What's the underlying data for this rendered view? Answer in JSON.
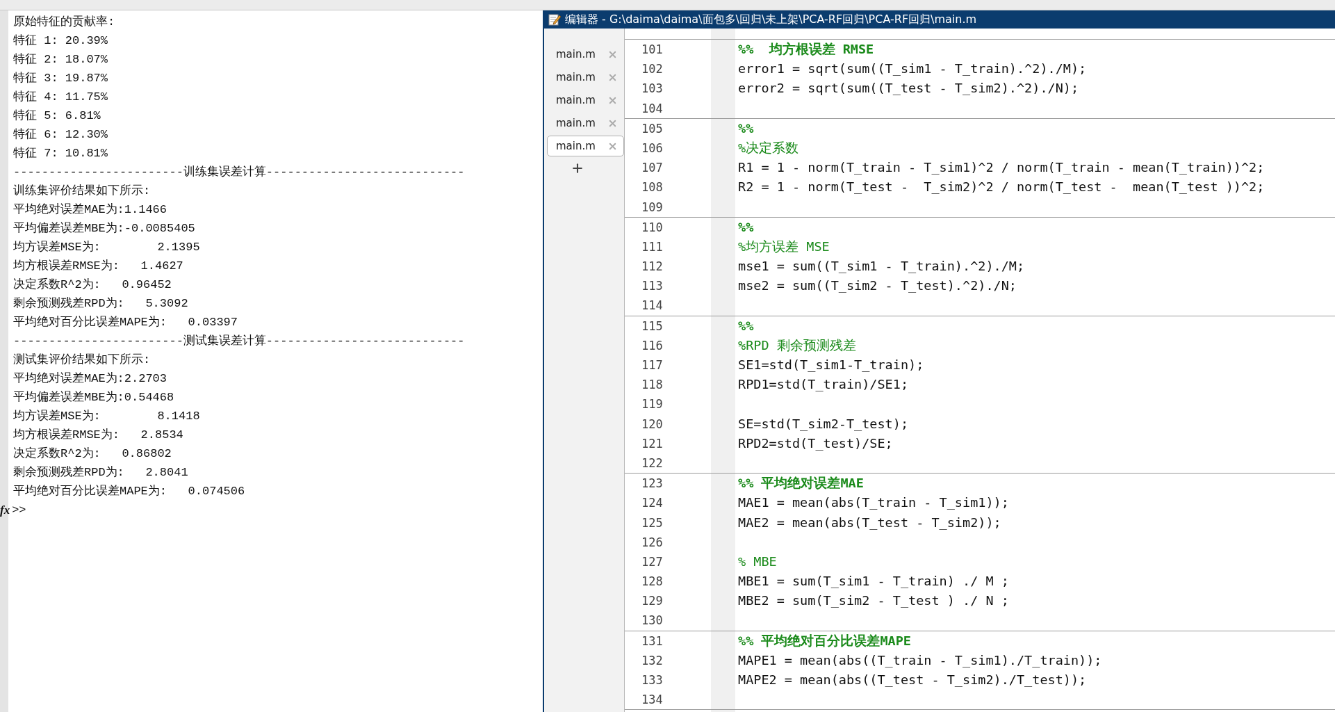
{
  "console": {
    "lines": [
      {
        "kind": "text",
        "text": "原始特征的贡献率:"
      },
      {
        "kind": "text",
        "text": "特征 1: 20.39%"
      },
      {
        "kind": "text",
        "text": "特征 2: 18.07%"
      },
      {
        "kind": "text",
        "text": "特征 3: 19.87%"
      },
      {
        "kind": "text",
        "text": "特征 4: 11.75%"
      },
      {
        "kind": "text",
        "text": "特征 5: 6.81%"
      },
      {
        "kind": "text",
        "text": "特征 6: 12.30%"
      },
      {
        "kind": "text",
        "text": "特征 7: 10.81%"
      },
      {
        "kind": "text",
        "text": "------------------------训练集误差计算----------------------------"
      },
      {
        "kind": "text",
        "text": "训练集评价结果如下所示:"
      },
      {
        "kind": "text",
        "text": "平均绝对误差MAE为:1.1466"
      },
      {
        "kind": "text",
        "text": "平均偏差误差MBE为:-0.0085405"
      },
      {
        "kind": "text",
        "text": "均方误差MSE为:        2.1395"
      },
      {
        "kind": "text",
        "text": "均方根误差RMSE为:   1.4627"
      },
      {
        "kind": "text",
        "text": "决定系数R^2为:   0.96452"
      },
      {
        "kind": "text",
        "text": "剩余预测残差RPD为:   5.3092"
      },
      {
        "kind": "text",
        "text": "平均绝对百分比误差MAPE为:   0.03397"
      },
      {
        "kind": "text",
        "text": "------------------------测试集误差计算----------------------------"
      },
      {
        "kind": "text",
        "text": "测试集评价结果如下所示:"
      },
      {
        "kind": "text",
        "text": "平均绝对误差MAE为:2.2703"
      },
      {
        "kind": "text",
        "text": "平均偏差误差MBE为:0.54468"
      },
      {
        "kind": "text",
        "text": "均方误差MSE为:        8.1418"
      },
      {
        "kind": "text",
        "text": "均方根误差RMSE为:   2.8534"
      },
      {
        "kind": "text",
        "text": "决定系数R^2为:   0.86802"
      },
      {
        "kind": "text",
        "text": "剩余预测残差RPD为:   2.8041"
      },
      {
        "kind": "text",
        "text": "平均绝对百分比误差MAPE为:   0.074506"
      }
    ],
    "fx": "fx",
    "prompt": ">>"
  },
  "editor": {
    "title": "编辑器 - G:\\daima\\daima\\面包多\\回归\\未上架\\PCA-RF回归\\PCA-RF回归\\main.m",
    "tabs": [
      {
        "label": "main.m",
        "selected": false
      },
      {
        "label": "main.m",
        "selected": false
      },
      {
        "label": "main.m",
        "selected": false
      },
      {
        "label": "main.m",
        "selected": false
      },
      {
        "label": "main.m",
        "selected": true
      }
    ],
    "sections": [
      {
        "lines": [
          {
            "n": "101",
            "kind": "cell-title",
            "text": "%%  均方根误差 RMSE"
          },
          {
            "n": "102",
            "kind": "code",
            "text": "error1 = sqrt(sum((T_sim1 - T_train).^2)./M);"
          },
          {
            "n": "103",
            "kind": "code",
            "text": "error2 = sqrt(sum((T_test - T_sim2).^2)./N);"
          },
          {
            "n": "104",
            "kind": "blank"
          }
        ]
      },
      {
        "lines": [
          {
            "n": "105",
            "kind": "cell-title",
            "text": "%%"
          },
          {
            "n": "106",
            "kind": "comment",
            "text": "%决定系数"
          },
          {
            "n": "107",
            "kind": "code",
            "text": "R1 = 1 - norm(T_train - T_sim1)^2 / norm(T_train - mean(T_train))^2;"
          },
          {
            "n": "108",
            "kind": "code",
            "text": "R2 = 1 - norm(T_test -  T_sim2)^2 / norm(T_test -  mean(T_test ))^2;"
          },
          {
            "n": "109",
            "kind": "blank"
          }
        ]
      },
      {
        "lines": [
          {
            "n": "110",
            "kind": "cell-title",
            "text": "%%"
          },
          {
            "n": "111",
            "kind": "comment",
            "text": "%均方误差 MSE"
          },
          {
            "n": "112",
            "kind": "code",
            "text": "mse1 = sum((T_sim1 - T_train).^2)./M;"
          },
          {
            "n": "113",
            "kind": "code",
            "text": "mse2 = sum((T_sim2 - T_test).^2)./N;"
          },
          {
            "n": "114",
            "kind": "blank"
          }
        ]
      },
      {
        "lines": [
          {
            "n": "115",
            "kind": "cell-title",
            "text": "%%"
          },
          {
            "n": "116",
            "kind": "comment",
            "text": "%RPD 剩余预测残差"
          },
          {
            "n": "117",
            "kind": "code",
            "text": "SE1=std(T_sim1-T_train);"
          },
          {
            "n": "118",
            "kind": "code",
            "text": "RPD1=std(T_train)/SE1;"
          },
          {
            "n": "119",
            "kind": "blank"
          },
          {
            "n": "120",
            "kind": "code",
            "text": "SE=std(T_sim2-T_test);"
          },
          {
            "n": "121",
            "kind": "code",
            "text": "RPD2=std(T_test)/SE;"
          },
          {
            "n": "122",
            "kind": "blank"
          }
        ]
      },
      {
        "lines": [
          {
            "n": "123",
            "kind": "cell-title",
            "text": "%% 平均绝对误差MAE"
          },
          {
            "n": "124",
            "kind": "code",
            "text": "MAE1 = mean(abs(T_train - T_sim1));"
          },
          {
            "n": "125",
            "kind": "code",
            "text": "MAE2 = mean(abs(T_test - T_sim2));"
          },
          {
            "n": "126",
            "kind": "blank"
          },
          {
            "n": "127",
            "kind": "comment",
            "text": "% MBE"
          },
          {
            "n": "128",
            "kind": "code",
            "text": "MBE1 = sum(T_sim1 - T_train) ./ M ;"
          },
          {
            "n": "129",
            "kind": "code",
            "text": "MBE2 = sum(T_sim2 - T_test ) ./ N ;"
          },
          {
            "n": "130",
            "kind": "blank"
          }
        ]
      },
      {
        "lines": [
          {
            "n": "131",
            "kind": "cell-title",
            "text": "%% 平均绝对百分比误差MAPE"
          },
          {
            "n": "132",
            "kind": "code",
            "text": "MAPE1 = mean(abs((T_train - T_sim1)./T_train));"
          },
          {
            "n": "133",
            "kind": "code",
            "text": "MAPE2 = mean(abs((T_test - T_sim2)./T_test));"
          },
          {
            "n": "134",
            "kind": "blank"
          }
        ]
      }
    ]
  }
}
